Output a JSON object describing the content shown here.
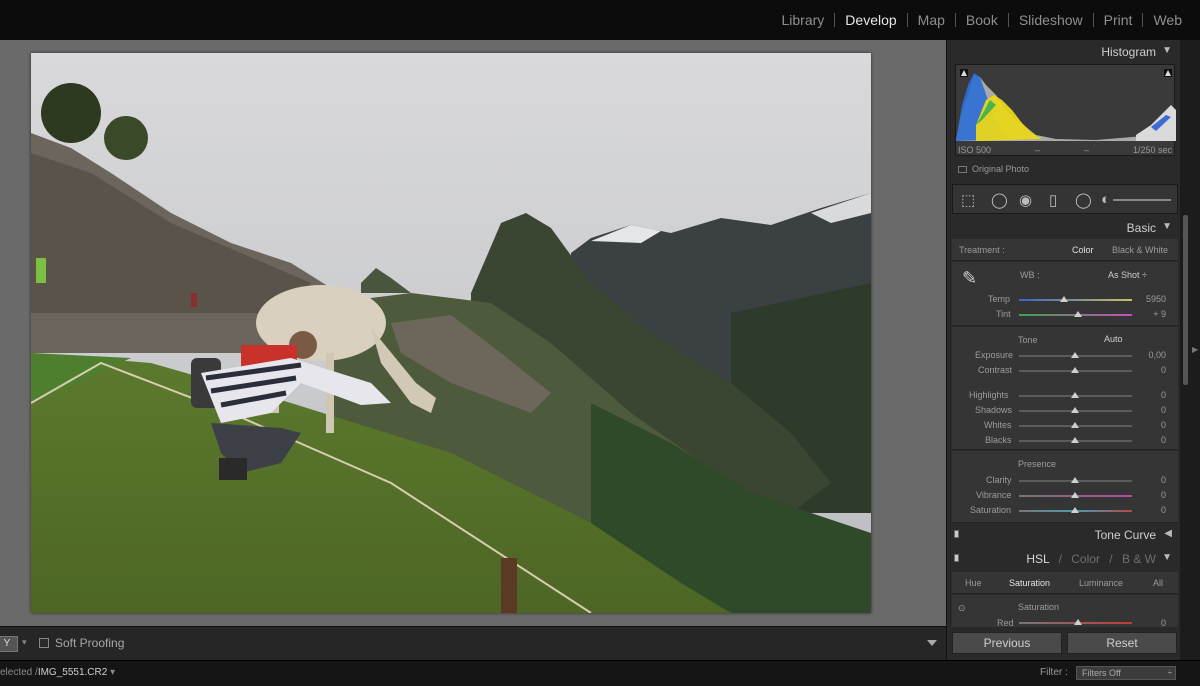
{
  "modules": [
    "Library",
    "Develop",
    "Map",
    "Book",
    "Slideshow",
    "Print",
    "Web"
  ],
  "active_module": "Develop",
  "photo": {
    "file": "IMG_5551.CR2"
  },
  "toolbar": {
    "view_glyph": "Y",
    "soft_proofing": "Soft Proofing"
  },
  "status": {
    "path_prefix": "elected /",
    "file": "IMG_5551.CR2",
    "filter_label": "Filter :",
    "filter_value": "Filters Off"
  },
  "histogram": {
    "title": "Histogram",
    "iso": "ISO 500",
    "dash1": "–",
    "dash2": "–",
    "shutter": "1/250 sec",
    "original_photo": "Original Photo"
  },
  "basic": {
    "title": "Basic",
    "treatment_label": "Treatment :",
    "treatment_color": "Color",
    "treatment_bw": "Black & White",
    "wb_label": "WB :",
    "wb_value": "As Shot ÷",
    "temp_label": "Temp",
    "temp_value": "5950",
    "tint_label": "Tint",
    "tint_value": "+ 9",
    "tone_label": "Tone",
    "auto_label": "Auto",
    "exposure_label": "Exposure",
    "exposure_value": "0,00",
    "contrast_label": "Contrast",
    "contrast_value": "0",
    "highlights_label": "Highlights",
    "highlights_value": "0",
    "shadows_label": "Shadows",
    "shadows_value": "0",
    "whites_label": "Whites",
    "whites_value": "0",
    "blacks_label": "Blacks",
    "blacks_value": "0",
    "presence_label": "Presence",
    "clarity_label": "Clarity",
    "clarity_value": "0",
    "vibrance_label": "Vibrance",
    "vibrance_value": "0",
    "saturation_label": "Saturation",
    "saturation_value": "0"
  },
  "tone_curve": {
    "title": "Tone Curve"
  },
  "hsl": {
    "hsl": "HSL",
    "sep1": "/",
    "color": "Color",
    "sep2": "/",
    "bw": "B & W",
    "tabs": [
      "Hue",
      "Saturation",
      "Luminance",
      "All"
    ],
    "active_tab": "Saturation",
    "sub_title": "Saturation",
    "red_label": "Red",
    "red_value": "0"
  },
  "buttons": {
    "previous": "Previous",
    "reset": "Reset"
  }
}
